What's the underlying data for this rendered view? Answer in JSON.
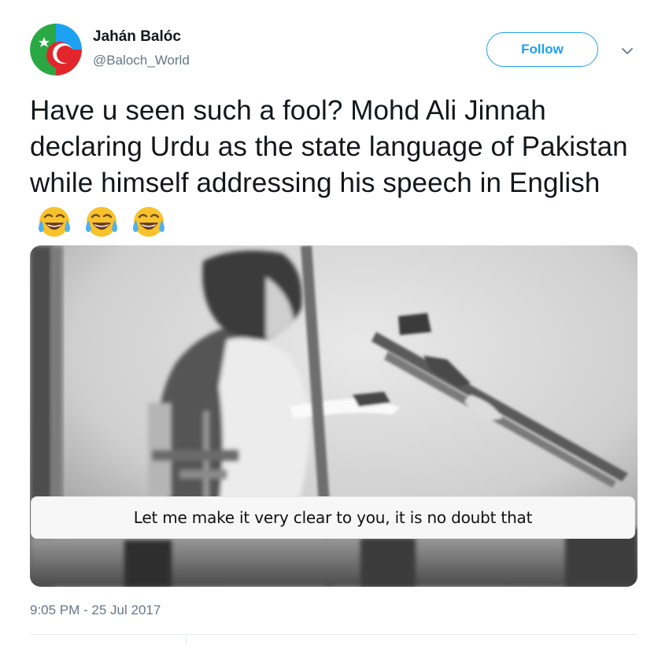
{
  "author": {
    "display_name": "Jahán Balóc",
    "handle": "@Baloch_World",
    "avatar_colors": [
      "#e2262b",
      "#2aa844",
      "#1da1f2"
    ]
  },
  "header": {
    "follow_label": "Follow",
    "more_icon": "chevron-down-icon"
  },
  "tweet": {
    "text": "Have u seen such a fool? Mohd Ali Jinnah declaring Urdu as the state language of Pakistan while himself addressing his speech in English",
    "emojis": [
      "face-with-tears-of-joy",
      "face-with-tears-of-joy",
      "face-with-tears-of-joy"
    ]
  },
  "media": {
    "type": "video-still",
    "caption": "Let me make it very clear to you, it is no doubt that"
  },
  "meta": {
    "timestamp": "9:05 PM - 25 Jul 2017"
  },
  "colors": {
    "accent": "#1da1f2",
    "secondary_text": "#657786",
    "primary_text": "#14171a"
  }
}
